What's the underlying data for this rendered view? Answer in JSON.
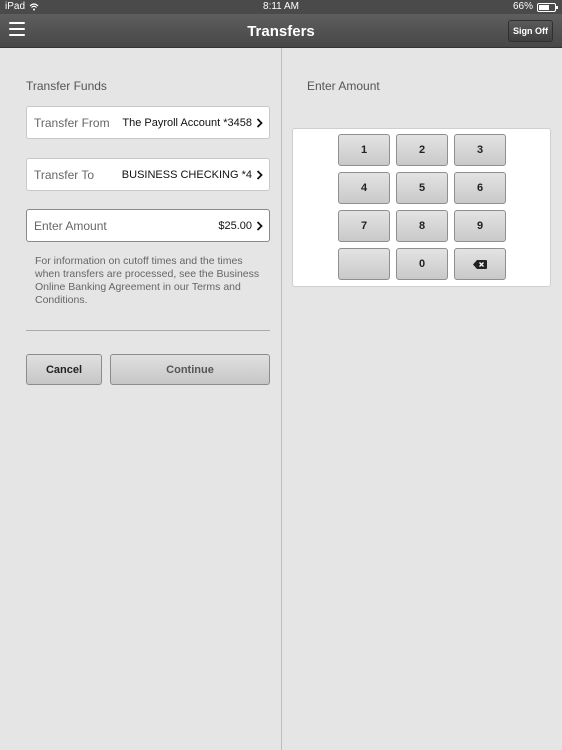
{
  "status_bar": {
    "device": "iPad",
    "time": "8:11 AM",
    "battery": "66%",
    "battery_level": 0.66
  },
  "nav": {
    "title": "Transfers",
    "sign_off": "Sign Off",
    "menu_icon": "hamburger-menu-icon"
  },
  "left": {
    "section_title": "Transfer Funds",
    "fields": [
      {
        "label": "Transfer From",
        "value": "The Payroll Account *3458"
      },
      {
        "label": "Transfer To",
        "value": "BUSINESS CHECKING *4"
      },
      {
        "label": "Enter Amount",
        "value": "$25.00"
      }
    ],
    "info": "For information on cutoff times and the times when transfers are processed, see the Business Online Banking Agreement in our Terms and Conditions.",
    "cancel_label": "Cancel",
    "continue_label": "Continue"
  },
  "right": {
    "section_title": "Enter Amount",
    "keys": [
      "1",
      "2",
      "3",
      "4",
      "5",
      "6",
      "7",
      "8",
      "9",
      "",
      "0",
      "backspace-icon"
    ]
  },
  "colors": {
    "nav_bg": "#4d4d4d",
    "panel_bg": "#e5e5e5"
  }
}
